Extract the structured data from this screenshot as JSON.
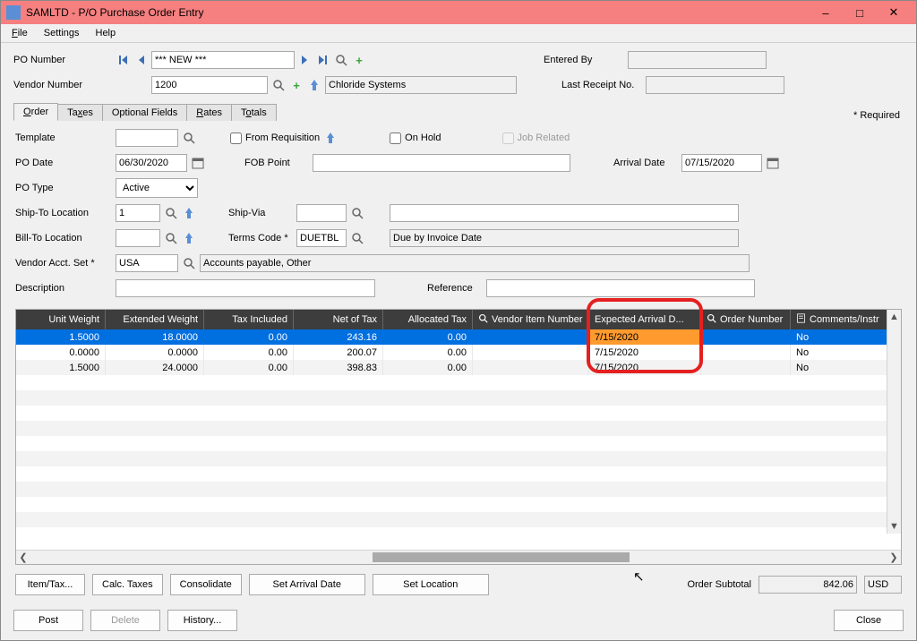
{
  "window": {
    "title": "SAMLTD - P/O Purchase Order Entry"
  },
  "menubar": {
    "file": "File",
    "settings": "Settings",
    "help": "Help"
  },
  "header": {
    "po_number_label": "PO Number",
    "po_number_value": "*** NEW ***",
    "vendor_number_label": "Vendor Number",
    "vendor_number_value": "1200",
    "vendor_name": "Chloride Systems",
    "entered_by_label": "Entered By",
    "entered_by_value": "",
    "last_receipt_label": "Last Receipt No.",
    "last_receipt_value": "",
    "required_note": "*  Required"
  },
  "tabs": {
    "order": "Order",
    "taxes": "Taxes",
    "optional_fields": "Optional Fields",
    "rates": "Rates",
    "totals": "Totals"
  },
  "order_page": {
    "template_label": "Template",
    "template_value": "",
    "from_requisition_label": "From Requisition",
    "on_hold_label": "On Hold",
    "job_related_label": "Job Related",
    "po_date_label": "PO Date",
    "po_date_value": "06/30/2020",
    "fob_point_label": "FOB Point",
    "fob_point_value": "",
    "arrival_date_label": "Arrival Date",
    "arrival_date_value": "07/15/2020",
    "po_type_label": "PO Type",
    "po_type_value": "Active",
    "shipto_label": "Ship-To Location",
    "shipto_value": "1",
    "shipvia_label": "Ship-Via",
    "shipvia_value": "",
    "shipvia_desc": "",
    "billto_label": "Bill-To Location",
    "billto_value": "",
    "terms_label": "Terms Code *",
    "terms_value": "DUETBL",
    "terms_desc": "Due by Invoice Date",
    "vendor_acct_label": "Vendor Acct. Set *",
    "vendor_acct_value": "USA",
    "vendor_acct_desc": "Accounts payable, Other",
    "description_label": "Description",
    "description_value": "",
    "reference_label": "Reference",
    "reference_value": ""
  },
  "grid": {
    "columns": {
      "unit_weight": "Unit Weight",
      "extended_weight": "Extended Weight",
      "tax_included": "Tax Included",
      "net_of_tax": "Net of Tax",
      "allocated_tax": "Allocated Tax",
      "vendor_item": "Vendor Item Number",
      "expected_arrival": "Expected Arrival D...",
      "order_number": "Order Number",
      "comments": "Comments/Instr"
    },
    "rows": [
      {
        "unit_weight": "1.5000",
        "extended_weight": "18.0000",
        "tax_included": "0.00",
        "net_of_tax": "243.16",
        "allocated_tax": "0.00",
        "vendor_item": "",
        "expected_arrival": "7/15/2020",
        "order_number": "",
        "comments": "No"
      },
      {
        "unit_weight": "0.0000",
        "extended_weight": "0.0000",
        "tax_included": "0.00",
        "net_of_tax": "200.07",
        "allocated_tax": "0.00",
        "vendor_item": "",
        "expected_arrival": "7/15/2020",
        "order_number": "",
        "comments": "No"
      },
      {
        "unit_weight": "1.5000",
        "extended_weight": "24.0000",
        "tax_included": "0.00",
        "net_of_tax": "398.83",
        "allocated_tax": "0.00",
        "vendor_item": "",
        "expected_arrival": "7/15/2020",
        "order_number": "",
        "comments": "No"
      }
    ]
  },
  "buttons": {
    "item_tax": "Item/Tax...",
    "calc_taxes": "Calc. Taxes",
    "consolidate": "Consolidate",
    "set_arrival": "Set Arrival Date",
    "set_location": "Set Location",
    "order_subtotal_label": "Order Subtotal",
    "order_subtotal_value": "842.06",
    "order_subtotal_currency": "USD",
    "post": "Post",
    "delete": "Delete",
    "history": "History...",
    "close": "Close"
  }
}
